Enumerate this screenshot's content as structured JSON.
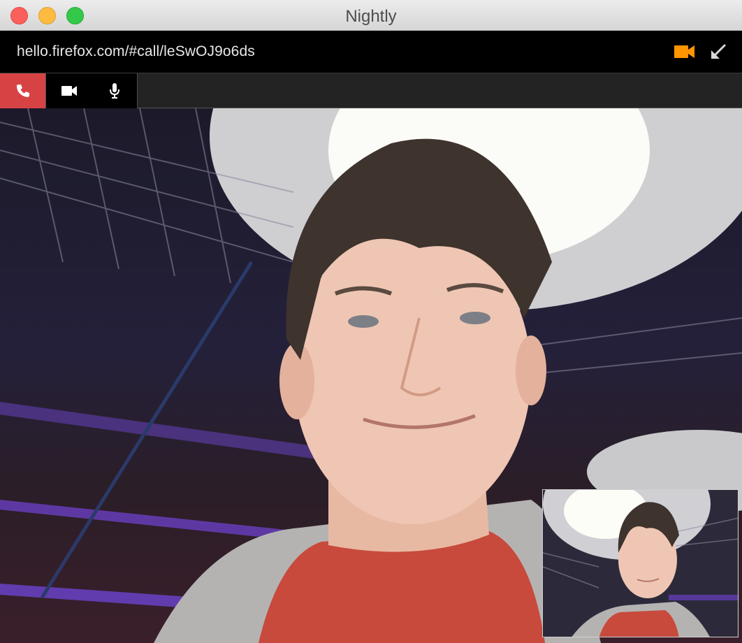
{
  "window": {
    "title": "Nightly"
  },
  "urlbar": {
    "url": "hello.firefox.com/#call/leSwOJ9o6ds",
    "video_icon_color": "#ff9500"
  },
  "toolbar": {
    "hangup_color": "#d74345",
    "buttons": [
      "hangup-icon",
      "video-camera-icon",
      "microphone-icon"
    ]
  },
  "icons": {
    "url_camera": "video-camera-icon",
    "url_shrink": "shrink-arrow-icon"
  }
}
